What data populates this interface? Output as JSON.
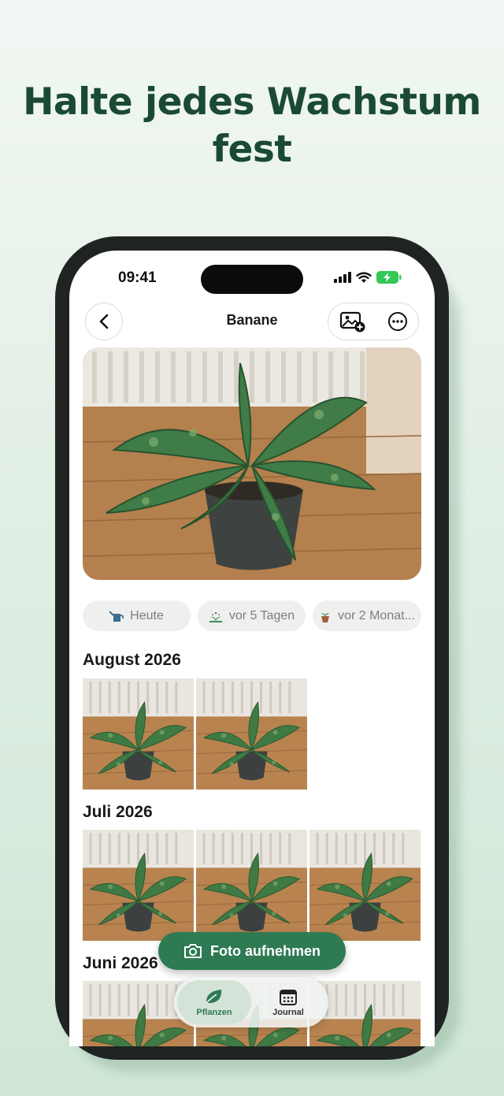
{
  "headline": {
    "line1": "Halte jedes Wachstum",
    "line2": "fest"
  },
  "status_bar": {
    "time": "09:41"
  },
  "nav": {
    "title": "Banane"
  },
  "pills": [
    {
      "label": "Heute",
      "icon": "watering-can-icon"
    },
    {
      "label": "vor 5 Tagen",
      "icon": "fertilizer-icon"
    },
    {
      "label": "vor 2 Monat...",
      "icon": "repot-icon"
    }
  ],
  "sections": [
    {
      "title": "August 2026",
      "photo_count": 2
    },
    {
      "title": "Juli 2026",
      "photo_count": 3
    },
    {
      "title": "Juni 2026",
      "photo_count": 3
    }
  ],
  "fab": {
    "label": "Foto aufnehmen",
    "icon": "camera-icon"
  },
  "tabbar": {
    "tabs": [
      {
        "label": "Pflanzen",
        "icon": "leaf-icon",
        "active": true
      },
      {
        "label": "Journal",
        "icon": "calendar-icon",
        "active": false
      }
    ]
  },
  "colors": {
    "accent": "#2e7a52",
    "headline": "#1b4a33",
    "pill_bg": "#eef0ee"
  }
}
